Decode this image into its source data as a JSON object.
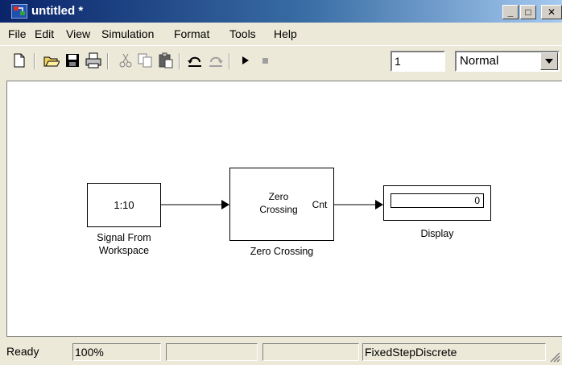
{
  "window": {
    "title": "untitled *"
  },
  "titlebar": {
    "min_glyph": "_",
    "max_glyph": "□",
    "close_glyph": "✕"
  },
  "menu": [
    "File",
    "Edit",
    "View",
    "Simulation",
    "Format",
    "Tools",
    "Help"
  ],
  "toolbar": {
    "icons": [
      "new-icon",
      "open-icon",
      "save-icon",
      "print-icon",
      "cut-icon",
      "copy-icon",
      "paste-icon",
      "undo-icon",
      "redo-icon",
      "play-icon",
      "stop-icon"
    ],
    "stop_time": "1",
    "mode": "Normal"
  },
  "model": {
    "source_block": {
      "text": "1:10",
      "label_line1": "Signal From",
      "label_line2": "Workspace"
    },
    "zero_block": {
      "text_line1": "Zero",
      "text_line2": "Crossing",
      "port": "Cnt",
      "label": "Zero Crossing"
    },
    "display_block": {
      "value": "0",
      "label": "Display"
    }
  },
  "status": {
    "state": "Ready",
    "zoom": "100%",
    "field1": "",
    "field2": "",
    "solver": "FixedStepDiscrete"
  },
  "colors": {
    "titlebar_start": "#0a246a",
    "titlebar_end": "#a6caf0",
    "chrome": "#ece9d8"
  }
}
